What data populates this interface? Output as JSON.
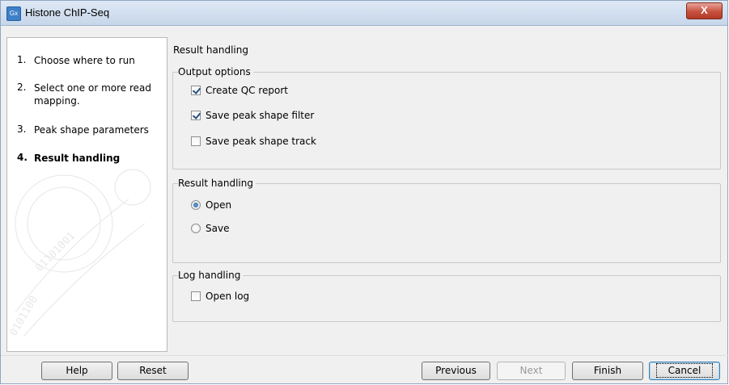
{
  "window": {
    "title": "Histone ChIP-Seq",
    "icon": "Gx",
    "close_glyph": "X"
  },
  "steps": [
    {
      "num": "1.",
      "label": "Choose where to run"
    },
    {
      "num": "2.",
      "label": "Select one or more read mapping."
    },
    {
      "num": "3.",
      "label": "Peak shape parameters"
    },
    {
      "num": "4.",
      "label": "Result handling"
    }
  ],
  "panel": {
    "heading": "Result handling",
    "output_options": {
      "title": "Output options",
      "create_qc_report": {
        "label": "Create QC report",
        "checked": true
      },
      "save_peak_shape_filter": {
        "label": "Save peak shape filter",
        "checked": true
      },
      "save_peak_shape_track": {
        "label": "Save peak shape track",
        "checked": false
      }
    },
    "result_handling": {
      "title": "Result handling",
      "open": {
        "label": "Open",
        "selected": true
      },
      "save": {
        "label": "Save",
        "selected": false
      }
    },
    "log_handling": {
      "title": "Log handling",
      "open_log": {
        "label": "Open log",
        "checked": false
      }
    }
  },
  "buttons": {
    "help": "Help",
    "reset": "Reset",
    "previous": "Previous",
    "next": "Next",
    "finish": "Finish",
    "cancel": "Cancel"
  }
}
